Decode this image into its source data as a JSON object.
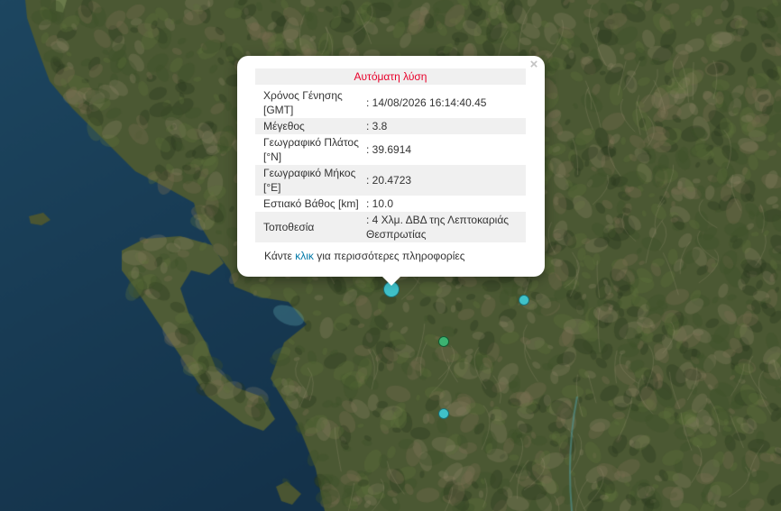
{
  "popup": {
    "title": "Αυτόματη λύση",
    "close_symbol": "×",
    "rows": [
      {
        "label": "Χρόνος Γένησης [GMT]",
        "value": ": 14/08/2026 16:14:40.45"
      },
      {
        "label": "Μέγεθος",
        "value": ": 3.8"
      },
      {
        "label": "Γεωγραφικό Πλάτος [°N]",
        "value": ": 39.6914"
      },
      {
        "label": "Γεωγραφικό Μήκος [°E]",
        "value": ": 20.4723"
      },
      {
        "label": "Εστιακό Βάθος [km]",
        "value": ": 10.0"
      },
      {
        "label": "Τοποθεσία",
        "value": ": 4 Χλμ. ΔΒΔ της Λεπτοκαριάς Θεσπρωτίας"
      }
    ],
    "more_prefix": "Κάντε ",
    "more_link": "κλικ",
    "more_suffix": " για περισσότερες πληροφορίες"
  },
  "markers": [
    {
      "name": "selected",
      "color": "#3fc1c9",
      "stroke": "#1d6e73"
    },
    {
      "name": "cyan-east",
      "color": "#3fc1c9",
      "stroke": "#1d6e73"
    },
    {
      "name": "green",
      "color": "#3cb371",
      "stroke": "#145a32"
    },
    {
      "name": "cyan-south",
      "color": "#3fc1c9",
      "stroke": "#1d6e73"
    }
  ],
  "colors": {
    "sea": "#1a3a4f",
    "land": "#4a5a32",
    "title_red": "#e8002a",
    "link": "#0078a8"
  }
}
